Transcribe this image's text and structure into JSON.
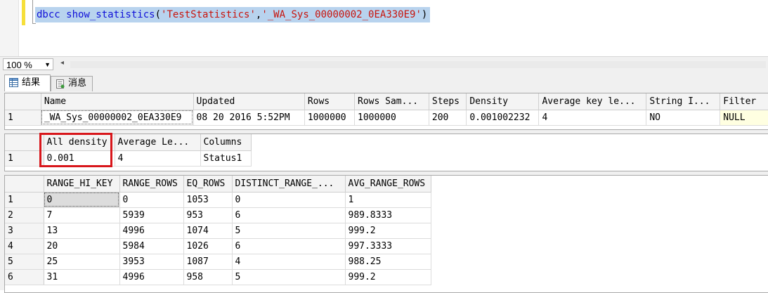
{
  "editor": {
    "code": {
      "keyword": "dbcc show_statistics",
      "open_paren": "(",
      "arg1": "'TestStatistics'",
      "comma": ",",
      "arg2": "'_WA_Sys_00000002_0EA330E9'",
      "close_paren": ")"
    },
    "colors": {
      "selection": "#b8d3ee",
      "keyword": "#1010d8",
      "string": "#c8140c"
    }
  },
  "zoom": {
    "value": "100 %"
  },
  "tabs": [
    {
      "label": "结果",
      "icon": "grid-icon",
      "active": true
    },
    {
      "label": "消息",
      "icon": "message-icon",
      "active": false
    }
  ],
  "header_grid": {
    "columns": [
      "Name",
      "Updated",
      "Rows",
      "Rows Sam...",
      "Steps",
      "Density",
      "Average key le...",
      "String I...",
      "Filter"
    ],
    "rows": [
      {
        "num": "1",
        "cells": [
          "_WA_Sys_00000002_0EA330E9",
          "08 20 2016  5:52PM",
          "1000000",
          "1000000",
          "200",
          "0.001002232",
          "4",
          "NO",
          "NULL"
        ]
      }
    ]
  },
  "density_grid": {
    "columns": [
      "All density",
      "Average Le...",
      "Columns"
    ],
    "rows": [
      {
        "num": "1",
        "cells": [
          "0.001",
          "4",
          "Status1"
        ]
      }
    ],
    "highlight_color": "#d8161b"
  },
  "histogram_grid": {
    "columns": [
      "RANGE_HI_KEY",
      "RANGE_ROWS",
      "EQ_ROWS",
      "DISTINCT_RANGE_...",
      "AVG_RANGE_ROWS"
    ],
    "rows": [
      {
        "num": "1",
        "cells": [
          "0",
          "0",
          "1053",
          "0",
          "1"
        ]
      },
      {
        "num": "2",
        "cells": [
          "7",
          "5939",
          "953",
          "6",
          "989.8333"
        ]
      },
      {
        "num": "3",
        "cells": [
          "13",
          "4996",
          "1074",
          "5",
          "999.2"
        ]
      },
      {
        "num": "4",
        "cells": [
          "20",
          "5984",
          "1026",
          "6",
          "997.3333"
        ]
      },
      {
        "num": "5",
        "cells": [
          "25",
          "3953",
          "1087",
          "4",
          "988.25"
        ]
      },
      {
        "num": "6",
        "cells": [
          "31",
          "4996",
          "958",
          "5",
          "999.2"
        ]
      }
    ]
  }
}
